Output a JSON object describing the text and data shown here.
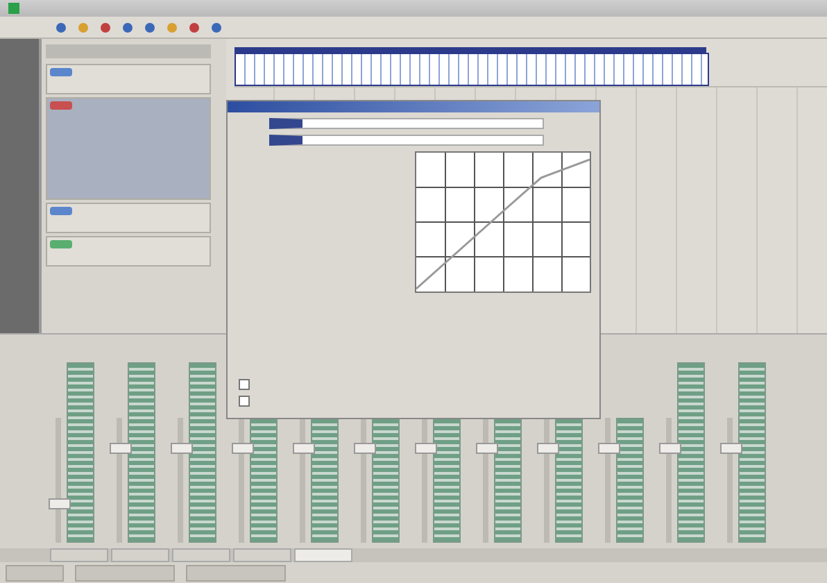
{
  "tracks": [
    {
      "color": "#5b86cc",
      "selected": false
    },
    {
      "color": "#c85050",
      "selected": true
    },
    {
      "color": "#5b86cc",
      "selected": false
    },
    {
      "color": "#5aae70",
      "selected": false
    }
  ],
  "dialog": {
    "options": [
      {
        "checked": false
      },
      {
        "checked": false
      }
    ]
  },
  "mixer": {
    "channels": [
      {
        "level": 0.3
      },
      {
        "level": 0.75
      },
      {
        "level": 0.75
      },
      {
        "level": 0.75
      },
      {
        "level": 0.75
      },
      {
        "level": 0.75
      },
      {
        "level": 0.75
      },
      {
        "level": 0.75
      },
      {
        "level": 0.75
      },
      {
        "level": 0.75
      },
      {
        "level": 0.75
      },
      {
        "level": 0.75
      }
    ]
  },
  "bottom_tabs": [
    {
      "selected": false
    },
    {
      "selected": false
    },
    {
      "selected": false
    },
    {
      "selected": false
    },
    {
      "selected": true
    }
  ]
}
